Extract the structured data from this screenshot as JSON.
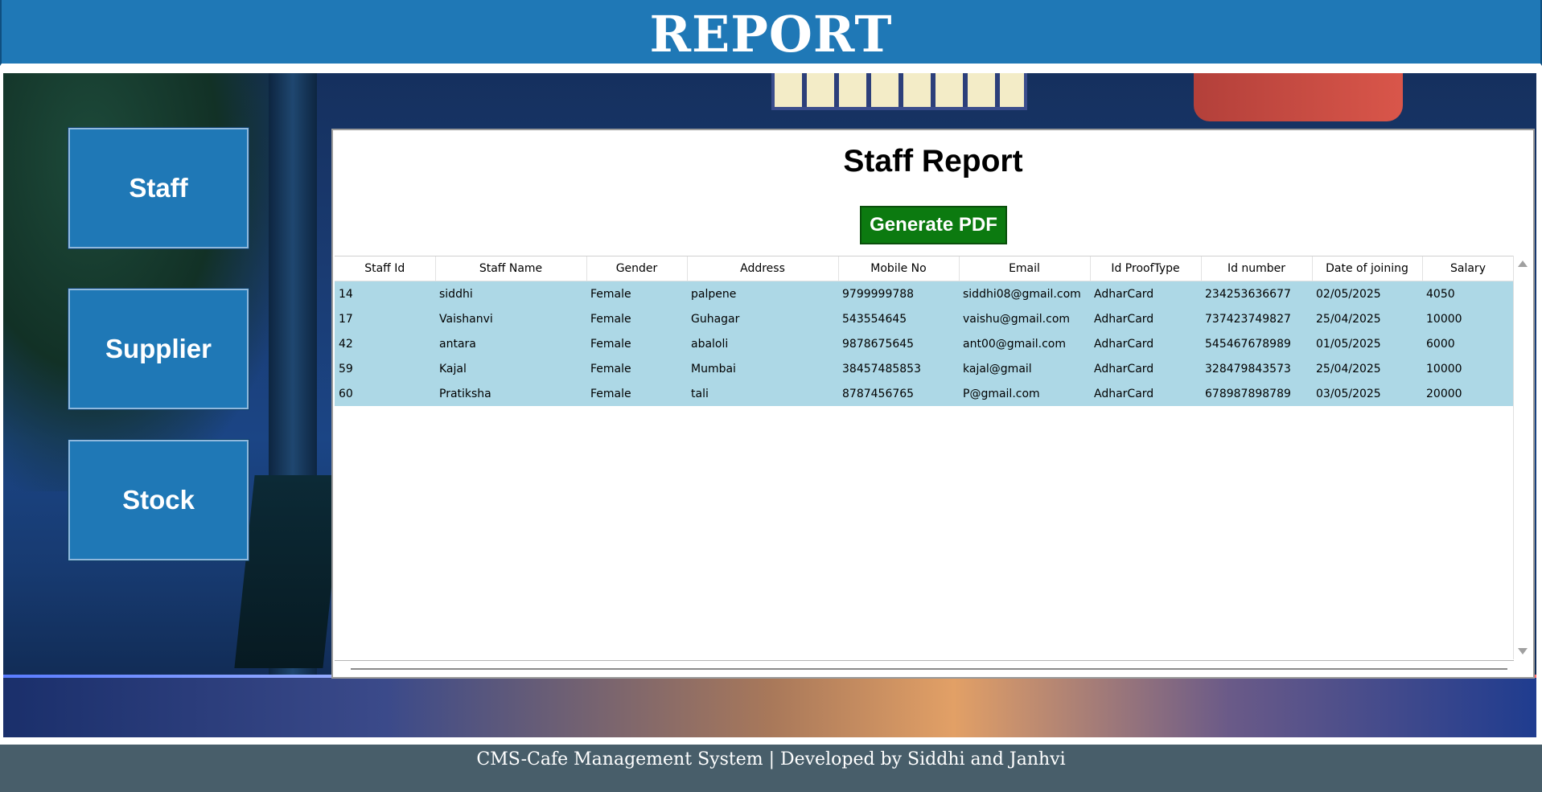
{
  "header": {
    "title": "REPORT"
  },
  "nav": {
    "items": [
      {
        "label": "Staff"
      },
      {
        "label": "Supplier"
      },
      {
        "label": "Stock"
      }
    ]
  },
  "panel": {
    "title": "Staff Report",
    "generate_pdf_label": "Generate PDF"
  },
  "table": {
    "columns": [
      "Staff Id",
      "Staff Name",
      "Gender",
      "Address",
      "Mobile No",
      "Email",
      "Id ProofType",
      "Id number",
      "Date of joining",
      "Salary"
    ],
    "rows": [
      [
        "14",
        "siddhi",
        "Female",
        "palpene",
        "9799999788",
        "siddhi08@gmail.com",
        "AdharCard",
        "234253636677",
        "02/05/2025",
        "4050"
      ],
      [
        "17",
        "Vaishanvi",
        "Female",
        "Guhagar",
        "543554645",
        "vaishu@gmail.com",
        "AdharCard",
        "737423749827",
        "25/04/2025",
        "10000"
      ],
      [
        "42",
        "antara",
        "Female",
        "abaloli",
        "9878675645",
        "ant00@gmail.com",
        "AdharCard",
        "545467678989",
        "01/05/2025",
        "6000"
      ],
      [
        "59",
        "Kajal",
        "Female",
        "Mumbai",
        "38457485853",
        "kajal@gmail",
        "AdharCard",
        "328479843573",
        "25/04/2025",
        "10000"
      ],
      [
        "60",
        "Pratiksha",
        "Female",
        "tali",
        "8787456765",
        "P@gmail.com",
        "AdharCard",
        "678987898789",
        "03/05/2025",
        "20000"
      ]
    ]
  },
  "footer": {
    "text": "CMS-Cafe Management System | Developed by Siddhi and Janhvi"
  },
  "colors": {
    "header_bg": "#1f78b6",
    "button_bg": "#1f78b6",
    "pdf_button_bg": "#0c7a10",
    "row_bg": "#add8e6",
    "footer_bg": "#485e6a"
  }
}
